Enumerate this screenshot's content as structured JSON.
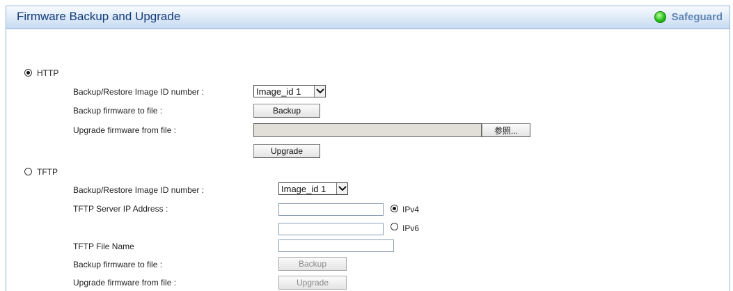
{
  "header": {
    "title": "Firmware Backup and Upgrade",
    "safeguard": "Safeguard"
  },
  "http": {
    "radio_label": "HTTP",
    "selected": true,
    "image_label": "Backup/Restore Image ID number :",
    "image_value": "Image_id 1",
    "backup_label": "Backup firmware to file :",
    "backup_button": "Backup",
    "upgrade_label": "Upgrade firmware from file :",
    "browse_button": "参照...",
    "upgrade_button": "Upgrade"
  },
  "tftp": {
    "radio_label": "TFTP",
    "selected": false,
    "image_label": "Backup/Restore Image ID number :",
    "image_value": "Image_id 1",
    "server_label": "TFTP Server IP Address :",
    "ipv4_label": "IPv4",
    "ipv6_label": "IPv6",
    "ipv4_value": "",
    "ipv6_value": "",
    "file_label": "TFTP File Name",
    "file_value": "",
    "backup_label": "Backup firmware to file :",
    "backup_button": "Backup",
    "upgrade_label": "Upgrade firmware from file :",
    "upgrade_button": "Upgrade"
  },
  "icons": {
    "status": "green-led-icon",
    "dropdown": "chevron-down-icon"
  },
  "colors": {
    "title_text": "#123c7a",
    "safeguard_text": "#5f86b5",
    "status_led": "#27c21b",
    "title_bar": "#dde9f7"
  }
}
